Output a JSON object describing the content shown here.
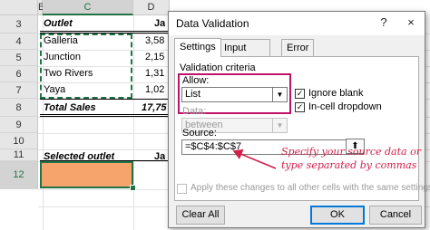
{
  "spreadsheet": {
    "columns": [
      {
        "label": "B"
      },
      {
        "label": "C"
      },
      {
        "label": "D"
      }
    ],
    "rows": [
      "3",
      "4",
      "5",
      "6",
      "7",
      "8",
      "9",
      "10",
      "11",
      "12"
    ],
    "header_outlet": "Outlet",
    "header_truncated": "Ja",
    "outlets": [
      "Galleria",
      "Junction",
      "Two Rivers",
      "Yaya"
    ],
    "partial_values": [
      "3,58",
      "2,15",
      "1,31",
      "1,02"
    ],
    "total_label": "Total Sales",
    "total_value": "17,75",
    "selected_outlet_label": "Selected outlet",
    "selected_header_truncated": "Ja",
    "selected_cell_color": "#f6a36c"
  },
  "dialog": {
    "title": "Data Validation",
    "help_button": "?",
    "close_button": "×",
    "tabs": [
      "Settings",
      "Input Message",
      "Error Alert"
    ],
    "active_tab": "Settings",
    "criteria_heading": "Validation criteria",
    "allow_label": "Allow:",
    "allow_value": "List",
    "ignore_blank_label": "Ignore blank",
    "ignore_blank_checked": true,
    "incell_dropdown_label": "In-cell dropdown",
    "incell_dropdown_checked": true,
    "data_label": "Data:",
    "data_value": "between",
    "source_label": "Source:",
    "source_value": "=$C$4:$C$7",
    "apply_all_label": "Apply these changes to all other cells with the same settings",
    "apply_all_checked": false,
    "clear_all_button": "Clear All",
    "ok_button": "OK",
    "cancel_button": "Cancel"
  },
  "annotation": {
    "callout_text": "Specify your source data or type separated by commas",
    "color": "#d11e4a"
  },
  "colors": {
    "accent_green": "#217346",
    "highlight_magenta": "#c0126a"
  }
}
